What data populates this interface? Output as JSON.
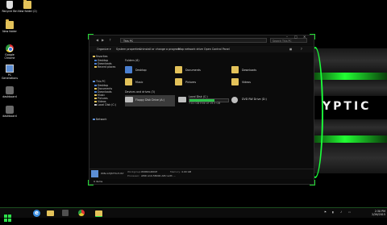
{
  "desktop": {
    "icons": [
      {
        "label": "Recycle Bin"
      },
      {
        "label": "New folder (2)"
      },
      {
        "label": "New folder"
      },
      {
        "label": "Google Chrome"
      },
      {
        "label": "PC Generations"
      },
      {
        "label": "dashboard"
      },
      {
        "label": "dashboard"
      }
    ],
    "brand_text": "YPTIC",
    "accent_color": "#22dd33"
  },
  "explorer": {
    "address": "This PC",
    "search_placeholder": "Search This PC",
    "ribbon": {
      "organize": "Organize ▾",
      "system_properties": "System properties",
      "uninstall": "Uninstall or change a program",
      "map_network": "Map network drive",
      "control_panel": "Open Control Panel"
    },
    "nav": [
      {
        "label": "Favorites"
      },
      {
        "label": "Desktop"
      },
      {
        "label": "Downloads"
      },
      {
        "label": "Recent places"
      },
      {
        "label": "This PC"
      },
      {
        "label": "Desktop"
      },
      {
        "label": "Documents"
      },
      {
        "label": "Downloads"
      },
      {
        "label": "Music"
      },
      {
        "label": "Pictures"
      },
      {
        "label": "Videos"
      },
      {
        "label": "Local Disk (C:)"
      },
      {
        "label": "Network"
      }
    ],
    "folders_header": "Folders (6)",
    "folders": [
      {
        "name": "Desktop"
      },
      {
        "name": "Documents"
      },
      {
        "name": "Downloads"
      },
      {
        "name": "Music"
      },
      {
        "name": "Pictures"
      },
      {
        "name": "Videos"
      }
    ],
    "devices_header": "Devices and drives (3)",
    "drives": [
      {
        "name": "Floppy Disk Drive (A:)",
        "free": "",
        "used_fraction": 0
      },
      {
        "name": "Local Disk (C:)",
        "free": "7.01 GB free of 19.5 GB",
        "used_fraction": 0.64
      },
      {
        "name": "DVD RW Drive (D:)",
        "free": "",
        "used_fraction": 0
      }
    ],
    "details": {
      "pc_name": "WIN-GHJSTTG7US7",
      "workgroup_label": "Workgroup:",
      "workgroup": "WORKGROUP",
      "processor_label": "Processor:",
      "processor": "AMD A10-5800K APU with ...",
      "memory_label": "Memory:",
      "memory": "4.00 GB"
    },
    "status": "9 items"
  },
  "taskbar": {
    "clock_time": "2:30 PM",
    "clock_date": "2/26/2015"
  }
}
